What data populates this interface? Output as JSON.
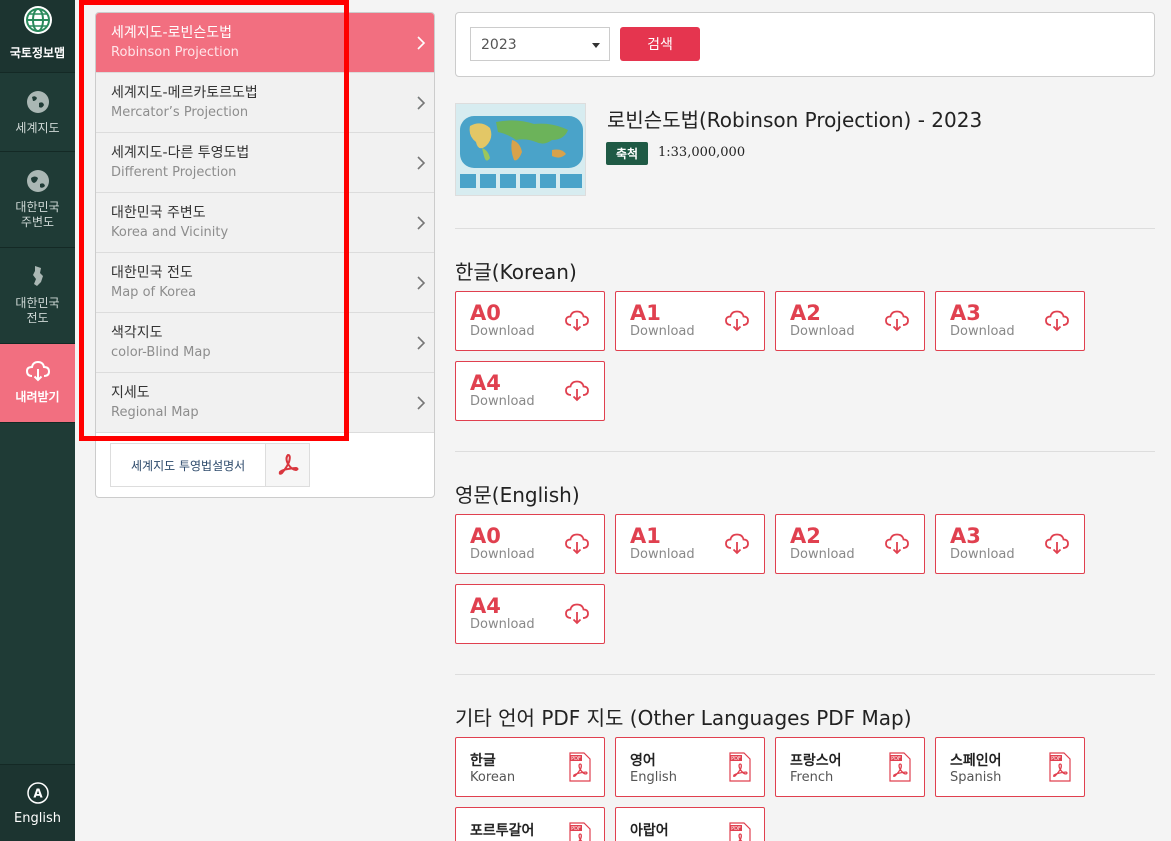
{
  "rail": {
    "logo_label": "국토정보맵",
    "items": [
      {
        "label": "세계지도",
        "icon": "globe-icon"
      },
      {
        "label": "대한민국\n주변도",
        "icon": "earth-icon"
      },
      {
        "label": "대한민국\n전도",
        "icon": "korea-map-icon"
      },
      {
        "label": "내려받기",
        "icon": "cloud-download-icon"
      }
    ],
    "language_label": "English",
    "active_color": "#f26f80"
  },
  "menu": {
    "items": [
      {
        "ko": "세계지도-로빈슨도법",
        "en": "Robinson Projection",
        "active": true
      },
      {
        "ko": "세계지도-메르카토르도법",
        "en": "Mercator’s Projection",
        "active": false
      },
      {
        "ko": "세계지도-다른 투영도법",
        "en": "Different Projection",
        "active": false
      },
      {
        "ko": "대한민국 주변도",
        "en": "Korea and Vicinity",
        "active": false
      },
      {
        "ko": "대한민국 전도",
        "en": "Map of Korea",
        "active": false
      },
      {
        "ko": "색각지도",
        "en": "color-Blind Map",
        "active": false
      },
      {
        "ko": "지세도",
        "en": "Regional Map",
        "active": false
      }
    ],
    "guide_label": "세계지도 투영법설명서"
  },
  "search": {
    "year": "2023",
    "button_label": "검색"
  },
  "map": {
    "title": "로빈슨도법(Robinson Projection) - 2023",
    "scale_badge": "축척",
    "scale_value": "1:33,000,000"
  },
  "sections": {
    "korean_title": "한글(Korean)",
    "english_title": "영문(English)",
    "other_title": "기타 언어 PDF 지도 (Other Languages PDF Map)"
  },
  "download_label": "Download",
  "sizes": [
    "A0",
    "A1",
    "A2",
    "A3",
    "A4"
  ],
  "languages": [
    {
      "ko": "한글",
      "en": "Korean"
    },
    {
      "ko": "영어",
      "en": "English"
    },
    {
      "ko": "프랑스어",
      "en": "French"
    },
    {
      "ko": "스페인어",
      "en": "Spanish"
    },
    {
      "ko": "포르투갈어",
      "en": ""
    },
    {
      "ko": "아랍어",
      "en": ""
    }
  ],
  "accent_color": "#e0404f"
}
